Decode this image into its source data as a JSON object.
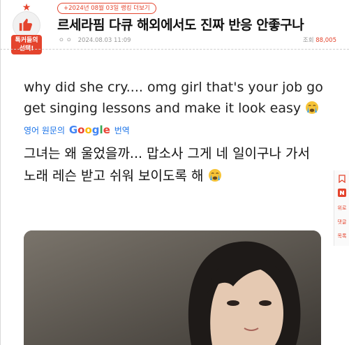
{
  "header": {
    "badge_label_line1": "톡커들의",
    "badge_label_line2": "선택!",
    "rank_link": "+2024년 08월 03일 랭킹 더보기",
    "title": "르세라핌 다큐 해외에서도 진짜 반응 안좋구나",
    "meta_dots": "ㅇㅇ",
    "date": "2024.08.03 11:09",
    "views_label": "조회",
    "views_count": "88,005"
  },
  "post": {
    "english_text": "why did she cry.... omg girl that's your job go get singing lessons and make it look easy",
    "translate_prefix": "영어 원문의",
    "translate_brand": "Google",
    "translate_suffix": "번역",
    "korean_text": "그녀는 왜 울었을까... 맙소사 그게 네 일이구나 가서 노래 레슨 받고 쉬워 보이도록 해",
    "emoji_name": "loudly-crying-face"
  },
  "sidebar": {
    "items": [
      {
        "icon": "bookmark-icon",
        "label": ""
      },
      {
        "icon": "n-logo-icon",
        "label": ""
      },
      {
        "label": "위로"
      },
      {
        "label": "댓글"
      },
      {
        "label": "목록"
      }
    ]
  },
  "colors": {
    "accent": "#e4442d",
    "link_blue": "#1a73e8"
  }
}
